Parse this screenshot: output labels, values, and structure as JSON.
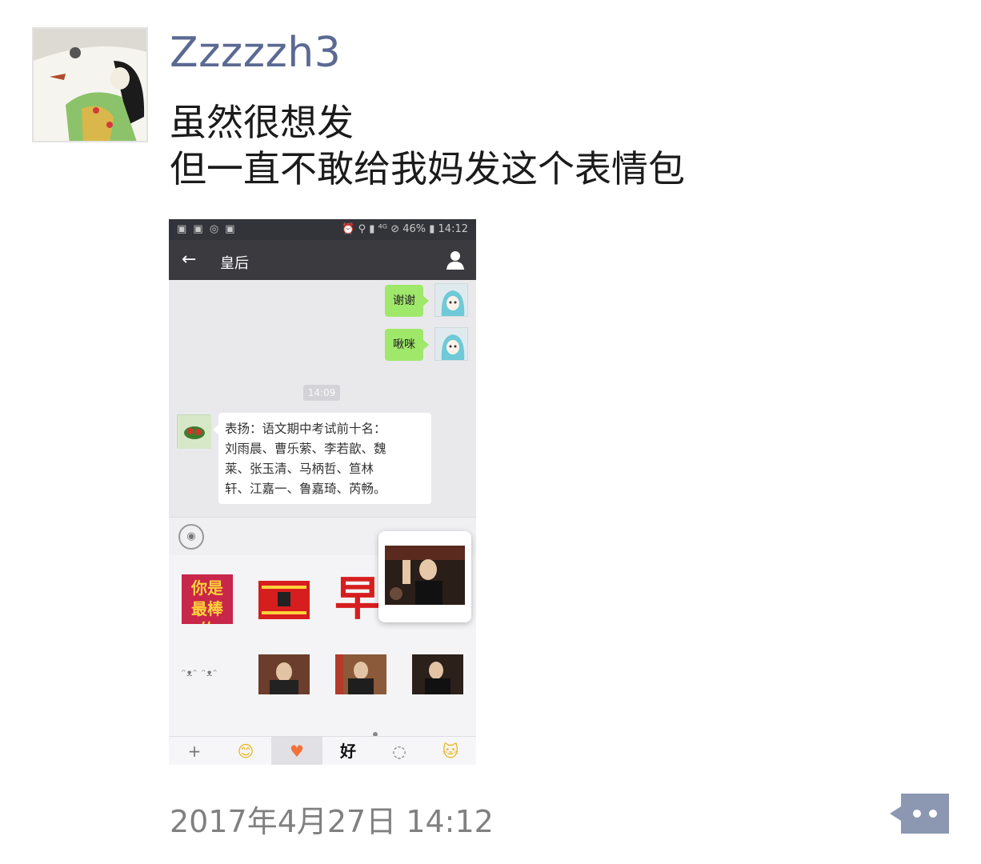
{
  "post": {
    "username": "Zzzzzh3",
    "text_line1": "虽然很想发",
    "text_line2": "但一直不敢给我妈发这个表情包",
    "timestamp": "2017年4月27日 14:12"
  },
  "screenshot": {
    "status_bar": {
      "left_icons": "▣ ▣ ◎ ▣",
      "right": "⏰ ⚲ ▮ ⁴ᴳ ⊘ 46% ▮ 14:12"
    },
    "header": {
      "back": "←",
      "title": "皇后"
    },
    "messages": [
      {
        "text": "谢谢"
      },
      {
        "text": "啾咪"
      }
    ],
    "time_divider": "14:09",
    "incoming_message": {
      "line1": "表扬：语文期中考试前十名：",
      "line2": "刘雨晨、曹乐萦、李若歆、魏",
      "line3": "莱、张玉清、马柄哲、笪林",
      "line4": "轩、江嘉一、鲁嘉琦、芮畅。"
    },
    "stickers": {
      "sticker1": "你是最棒的",
      "sticker3": "早"
    },
    "tabs": [
      "+",
      "😊",
      "♥",
      "好",
      "◌",
      "🐱"
    ]
  },
  "colors": {
    "username": "#5b6a92",
    "bubble_green": "#9fe86a",
    "titlebar": "#3a3a3f"
  }
}
